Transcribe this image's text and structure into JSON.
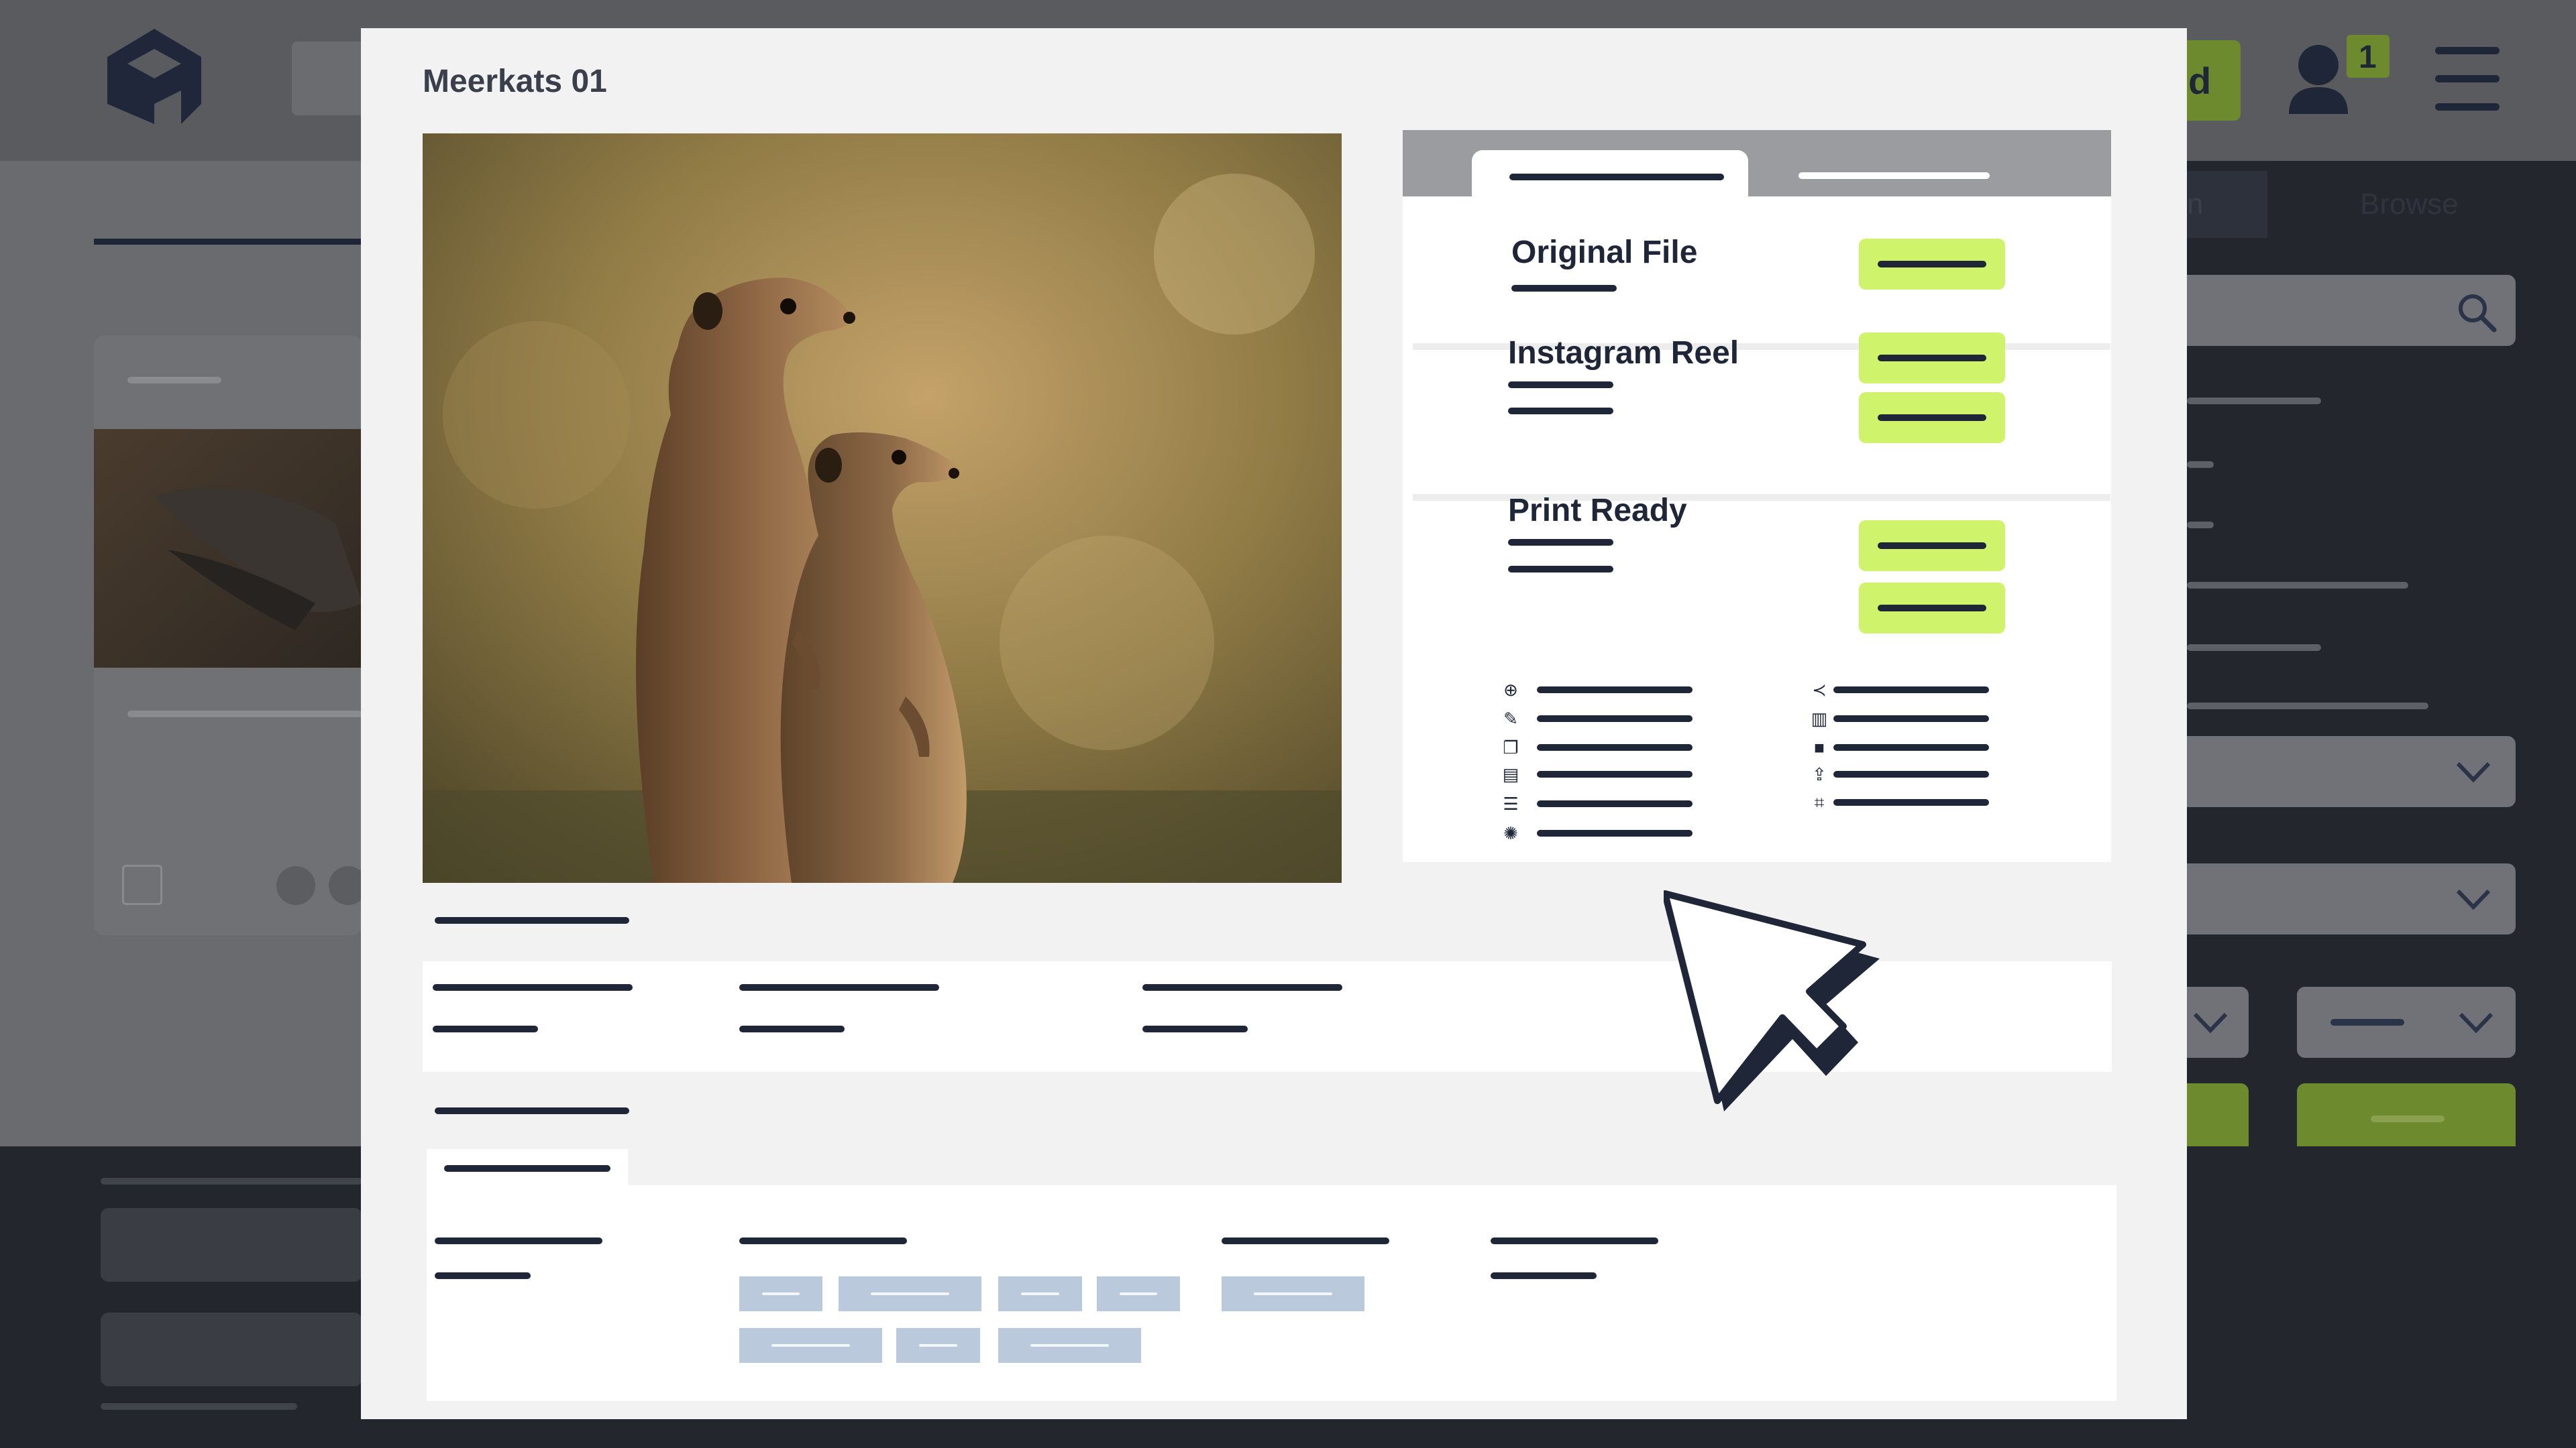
{
  "modal": {
    "title": "Meerkats 01"
  },
  "preview_image": {
    "alt": "Two meerkats standing upright"
  },
  "download_panel": {
    "sections": [
      {
        "title": "Original File",
        "buttons": 1
      },
      {
        "title": "Instagram Reel",
        "buttons": 2
      },
      {
        "title": "Print Ready",
        "buttons": 2
      }
    ]
  },
  "background_app": {
    "notification_count": "1",
    "header_button_fragment": "d",
    "tab_fragment": "n",
    "tab_browse": "Browse"
  },
  "colors": {
    "accent_green": "#cff36b",
    "navy": "#1f2637",
    "chip_blue": "#bac9dc",
    "modal_bg": "#f2f2f2"
  },
  "icons": {
    "actions_left": [
      "plus-circle-icon",
      "pencil-icon",
      "copy-icon",
      "document-icon",
      "list-icon",
      "sparkle-icon"
    ],
    "actions_right": [
      "share-icon",
      "trash-icon",
      "lock-icon",
      "upload-icon",
      "crop-icon"
    ]
  }
}
